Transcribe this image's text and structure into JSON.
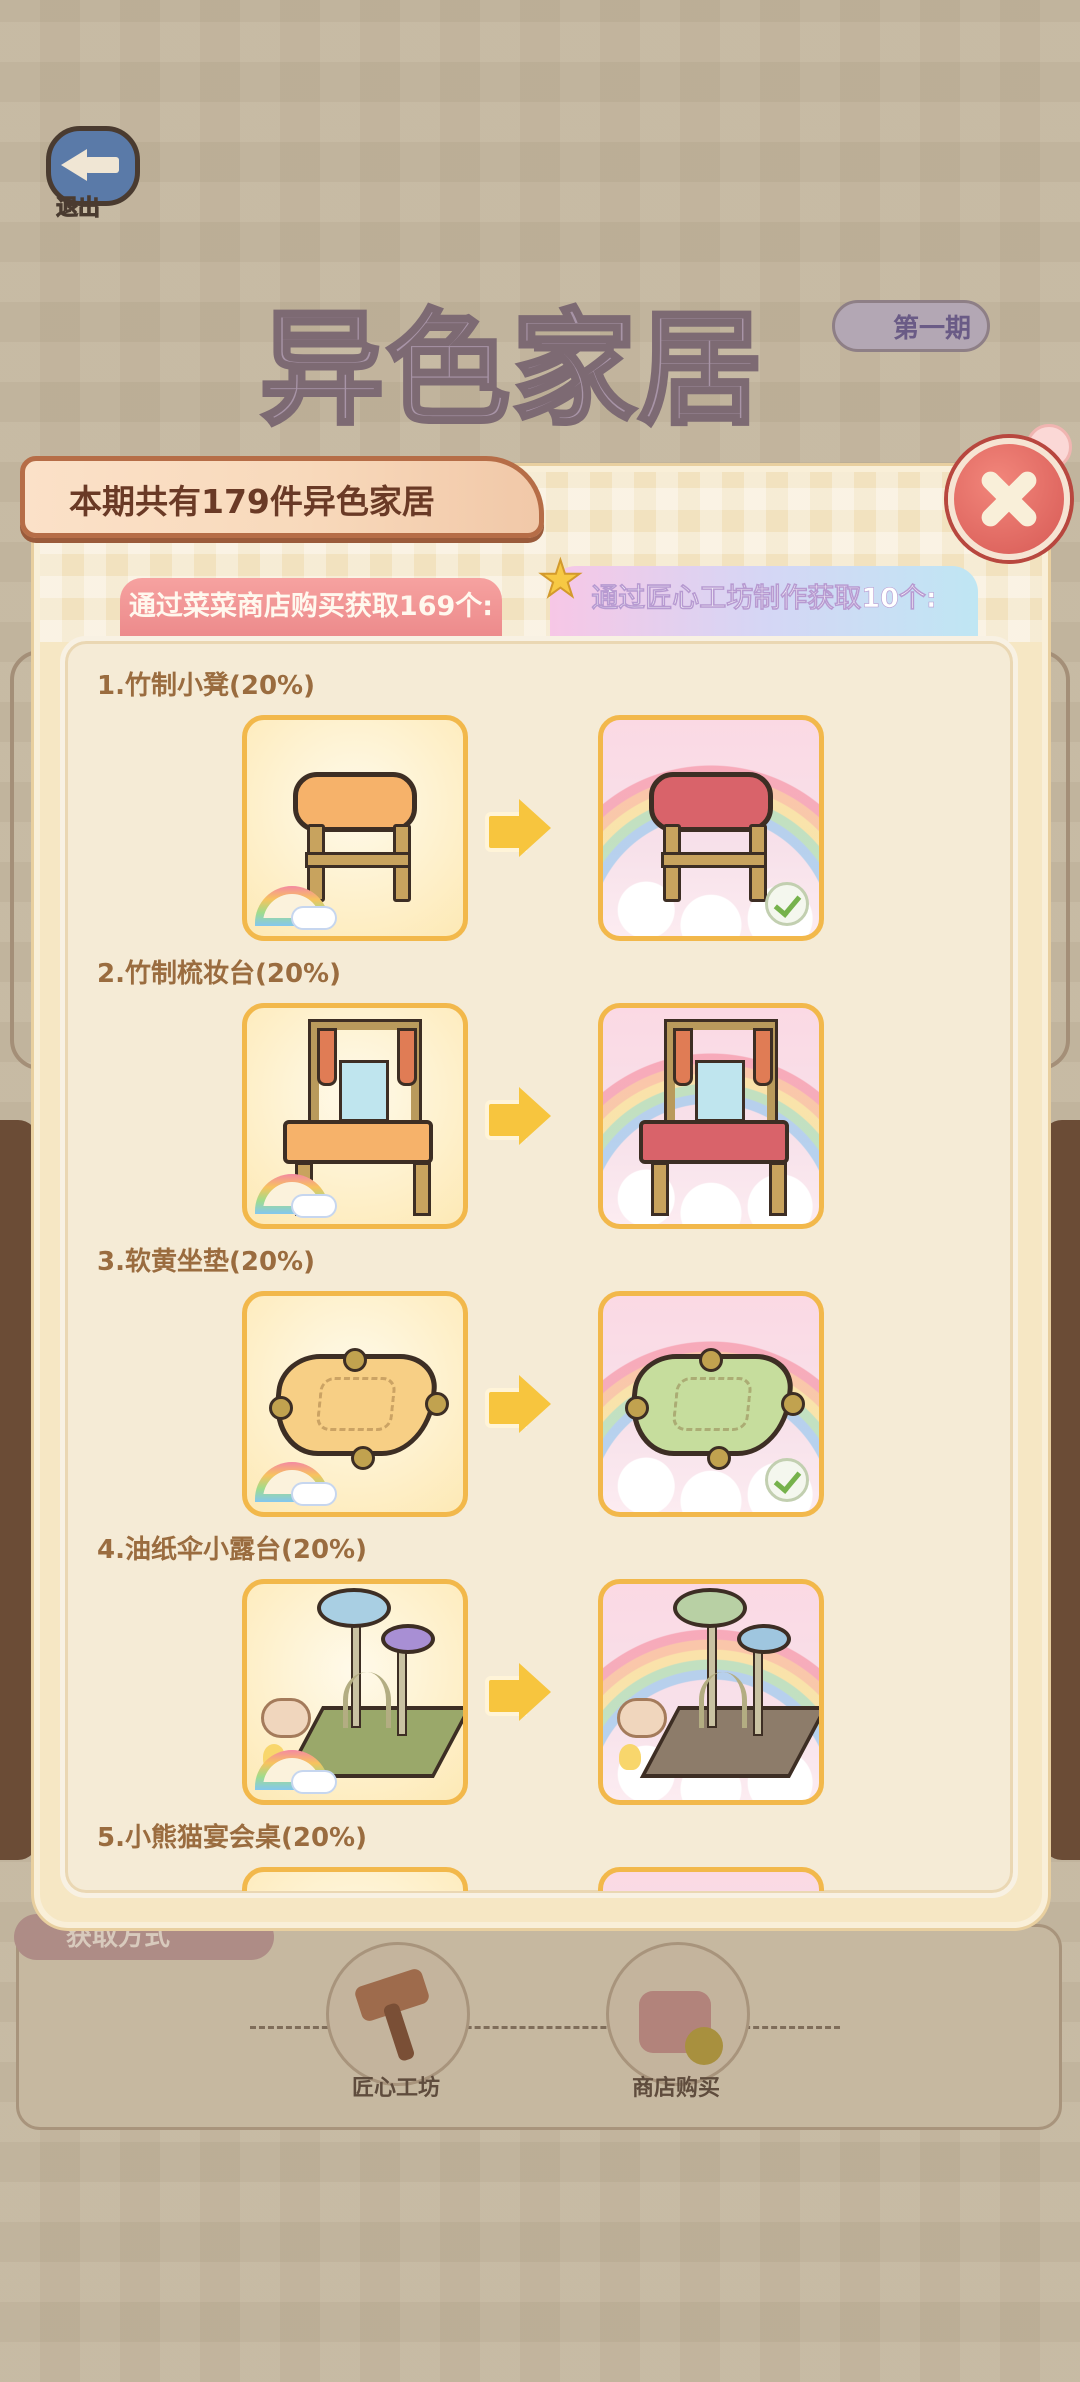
{
  "background": {
    "exit_label": "退出",
    "event_title": "异色家居",
    "issue_badge": "第一期",
    "acquire_tag": "获取方式",
    "sources": [
      {
        "label": "匠心工坊",
        "icon": "hammer-icon"
      },
      {
        "label": "商店购买",
        "icon": "shopping-bag-icon"
      }
    ]
  },
  "modal": {
    "title": "本期共有179件异色家居",
    "tabs": [
      {
        "label": "通过菜菜商店购买获取169个:",
        "active": true
      },
      {
        "label": "通过匠心工坊制作获取10个:",
        "active": false
      }
    ],
    "items": [
      {
        "label": "1.竹制小凳(20%)",
        "owned": true,
        "type": "stool"
      },
      {
        "label": "2.竹制梳妆台(20%)",
        "owned": false,
        "type": "vanity"
      },
      {
        "label": "3.软黄坐垫(20%)",
        "owned": true,
        "type": "cushion"
      },
      {
        "label": "4.油纸伞小露台(20%)",
        "owned": false,
        "type": "terrace"
      },
      {
        "label": "5.小熊猫宴会桌(20%)",
        "owned": false,
        "type": "table"
      }
    ]
  },
  "colors": {
    "accent_orange": "#f2b84b",
    "close_red": "#d75a55",
    "tab_red": "#ec8a8b",
    "label_brown": "#9a6c3f"
  }
}
